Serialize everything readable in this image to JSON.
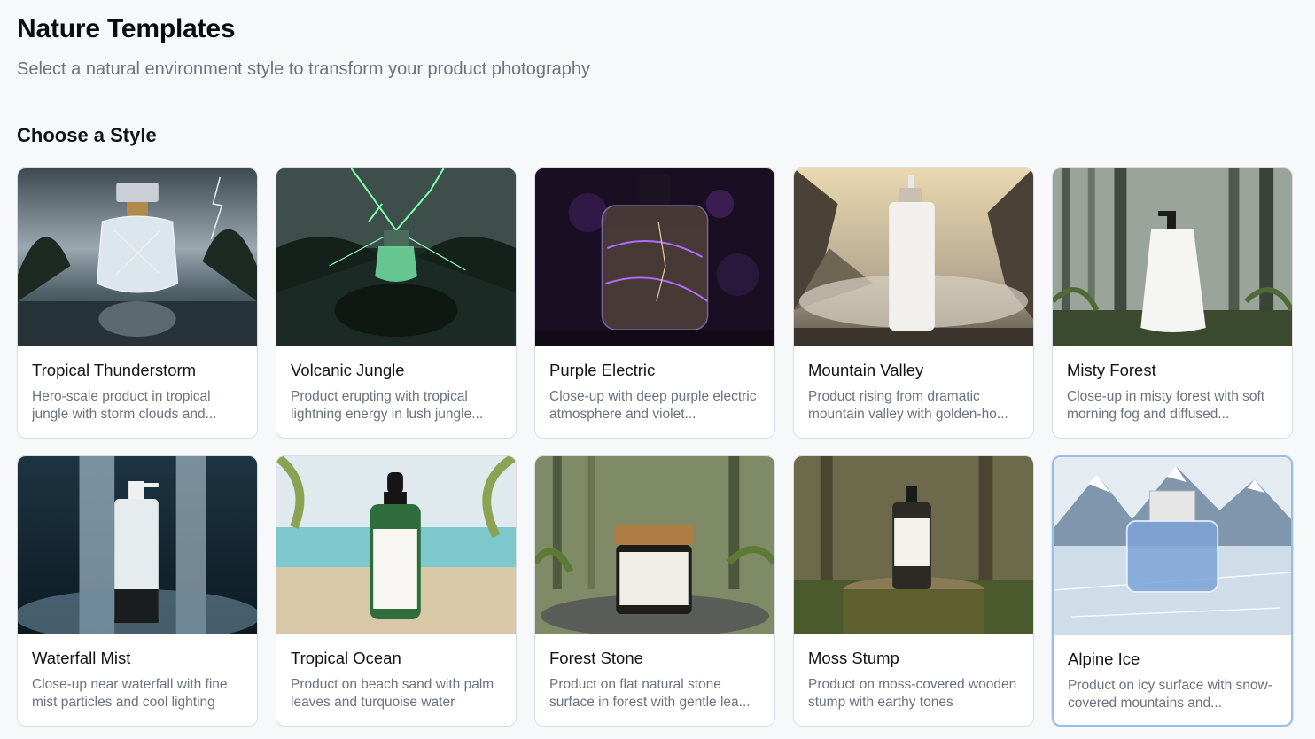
{
  "header": {
    "title": "Nature Templates",
    "subtitle": "Select a natural environment style to transform your product photography"
  },
  "section": {
    "title": "Choose a Style"
  },
  "selected_index": 9,
  "templates": [
    {
      "title": "Tropical Thunderstorm",
      "description": "Hero-scale product in tropical jungle with storm clouds and...",
      "image": "perfume-bottle-thunderstorm-image"
    },
    {
      "title": "Volcanic Jungle",
      "description": "Product erupting with tropical lightning energy in lush jungle...",
      "image": "bottle-green-lightning-image"
    },
    {
      "title": "Purple Electric",
      "description": "Close-up with deep purple electric atmosphere and violet...",
      "image": "bottle-purple-electric-image"
    },
    {
      "title": "Mountain Valley",
      "description": "Product rising from dramatic mountain valley with golden-ho...",
      "image": "pump-bottle-mountain-image"
    },
    {
      "title": "Misty Forest",
      "description": "Close-up in misty forest with soft morning fog and diffused...",
      "image": "soap-dispenser-forest-image"
    },
    {
      "title": "Waterfall Mist",
      "description": "Close-up near waterfall with fine mist particles and cool lighting",
      "image": "pump-bottle-waterfall-image"
    },
    {
      "title": "Tropical Ocean",
      "description": "Product on beach sand with palm leaves and turquoise water",
      "image": "dropper-bottle-beach-image"
    },
    {
      "title": "Forest Stone",
      "description": "Product on flat natural stone surface in forest with gentle lea...",
      "image": "jar-forest-stone-image"
    },
    {
      "title": "Moss Stump",
      "description": "Product on moss-covered wooden stump with earthy tones",
      "image": "pump-bottle-stump-image"
    },
    {
      "title": "Alpine Ice",
      "description": "Product on icy surface with snow-covered mountains and...",
      "image": "perfume-bottle-alpine-image"
    }
  ]
}
